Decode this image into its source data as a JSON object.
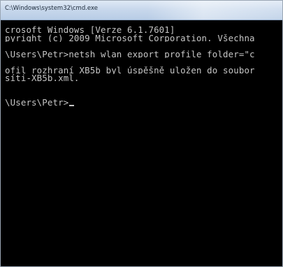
{
  "window": {
    "title": "C:\\Windows\\system32\\cmd.exe"
  },
  "console": {
    "lines": [
      "crosoft Windows [Verze 6.1.7601]",
      "pyright (c) 2009 Microsoft Corporation. Všechna",
      "",
      "\\Users\\Petr>netsh wlan export profile folder=\"c",
      "",
      "ofil rozhraní XB5b byl úspěšně uložen do soubor",
      "síti-XB5b.xml.",
      "",
      "",
      "\\Users\\Petr>"
    ]
  },
  "colors": {
    "console_background": "#000000",
    "console_text": "#c6c6c6",
    "titlebar": "#c8d8ec"
  }
}
